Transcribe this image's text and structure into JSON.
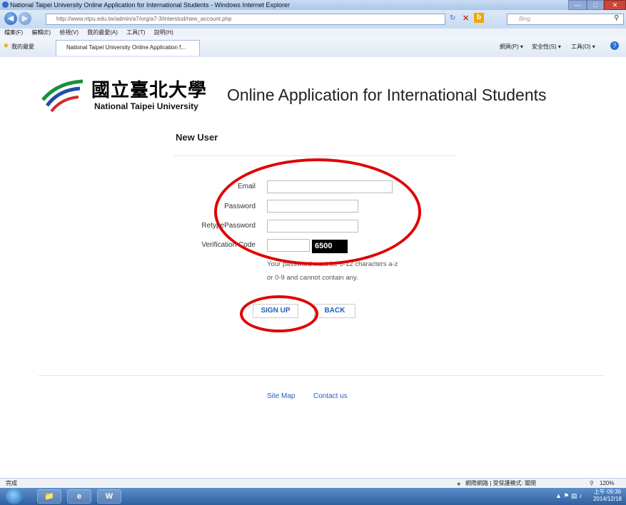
{
  "window": {
    "title": "National Taipei University Online Application for International Students - Windows Internet Explorer"
  },
  "browser": {
    "url": "http://www.ntpu.edu.tw/admin/a7/org/a7-3/interstud/new_account.php",
    "search_placeholder": "Bing",
    "menu": [
      "檔案(F)",
      "編輯(E)",
      "檢視(V)",
      "我的最愛(A)",
      "工具(T)",
      "說明(H)"
    ],
    "favorites_label": "我的最愛",
    "tab_title": "National Taipei University Online Application f...",
    "toolbar_right": [
      "網頁(P) ▾",
      "安全性(S) ▾",
      "工具(O) ▾"
    ]
  },
  "page": {
    "logo_cn": "國立臺北大學",
    "logo_en": "National Taipei University",
    "headline": "Online Application for International Students",
    "section_title": "New User",
    "form": {
      "email_label": "Email",
      "password_label": "Password",
      "retype_label": "RetypePassword",
      "verification_label": "Verification Code",
      "captcha": "6500",
      "hint_line1": "Your password must be 6-12 characters a-z",
      "hint_line2": "or 0-9 and cannot contain any.",
      "signup_label": "SIGN UP",
      "back_label": "BACK"
    },
    "footer": {
      "site_map": "Site Map",
      "contact_us": "Contact us"
    }
  },
  "statusbar": {
    "left": "完成",
    "zone": "網際網路 | 受保護模式: 關閉",
    "zoom": "120%"
  },
  "taskbar": {
    "time": "上午 09:36",
    "date": "2014/12/18"
  },
  "colors": {
    "annotation": "#e00000",
    "link": "#1f5fbf",
    "captcha_bg": "#000000"
  }
}
